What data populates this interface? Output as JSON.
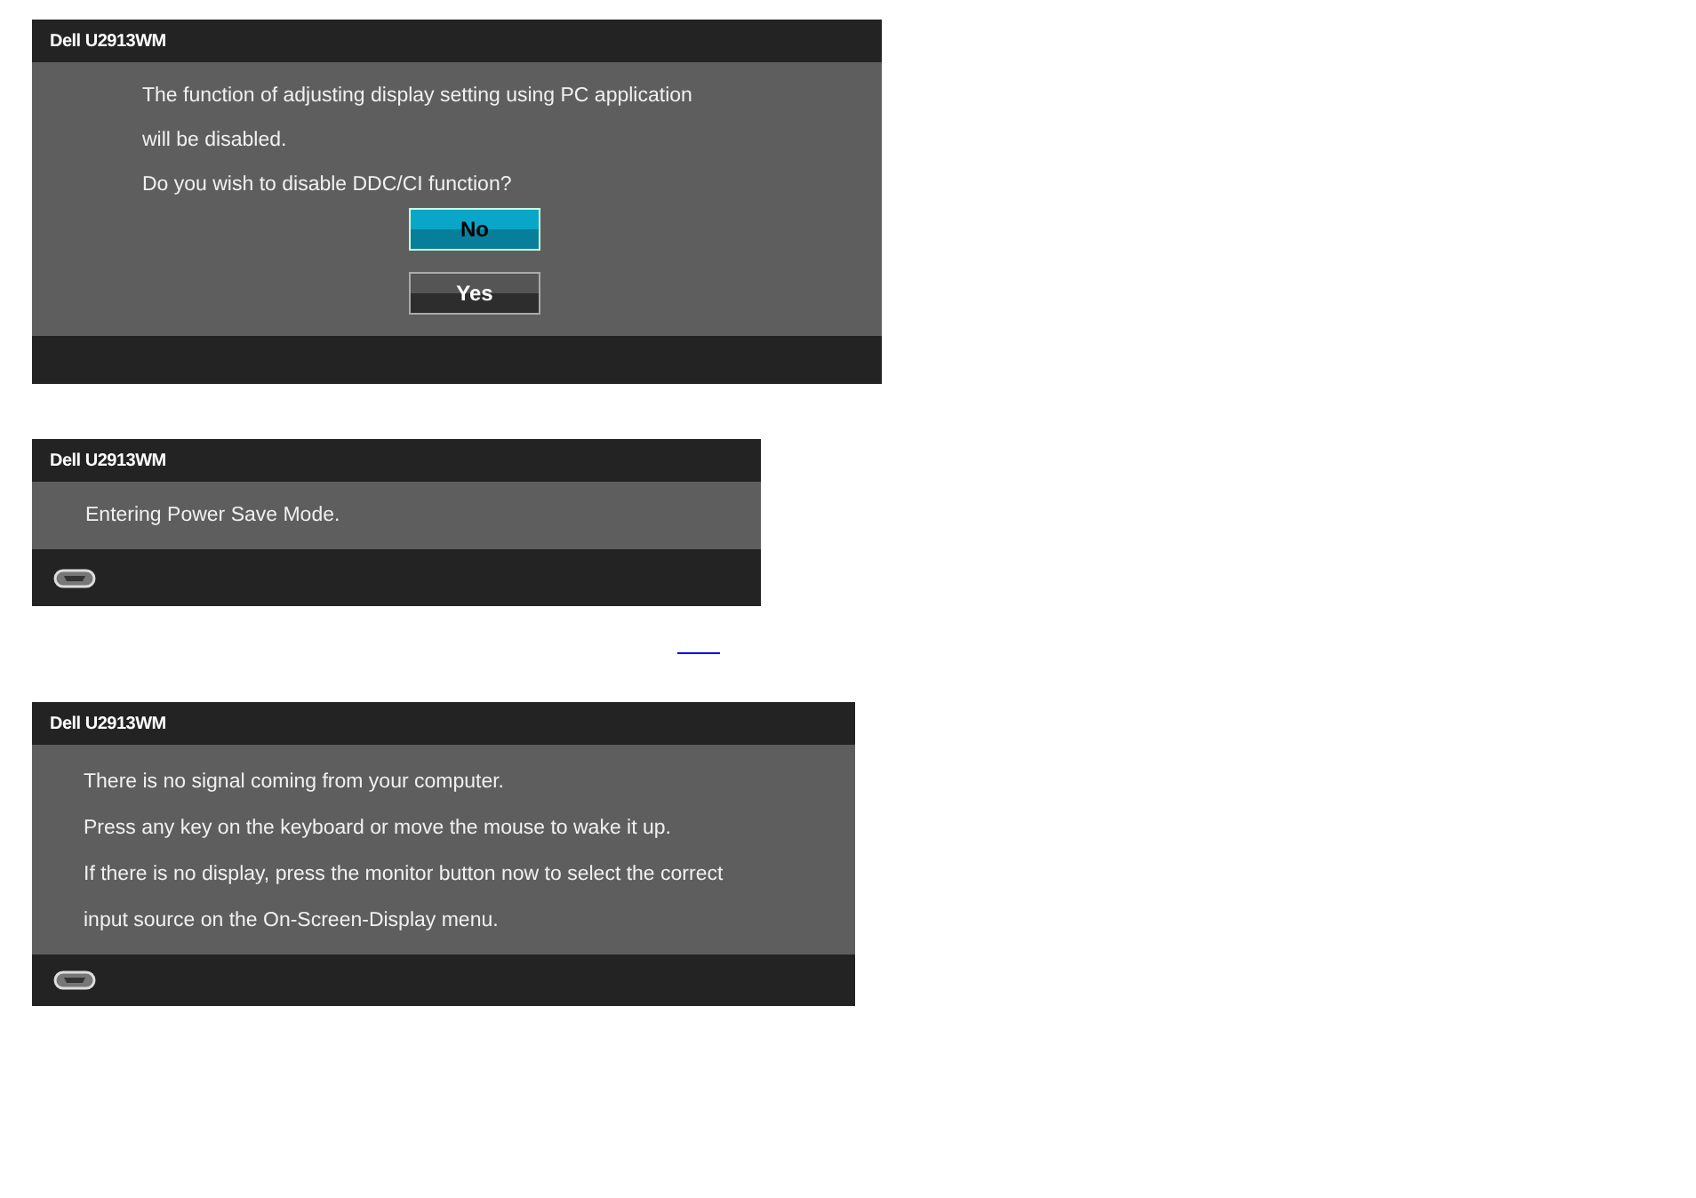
{
  "dialogs": [
    {
      "title": "Dell U2913WM",
      "kind": "confirm",
      "lines": [
        "The function of adjusting display setting using PC application",
        "will be disabled.",
        "Do you wish to disable DDC/CI function?"
      ],
      "buttons": [
        {
          "label": "No",
          "selected": true
        },
        {
          "label": "Yes",
          "selected": false
        }
      ],
      "footer_icon": false
    },
    {
      "title": "Dell U2913WM",
      "kind": "message",
      "lines": [
        "Entering Power Save Mode."
      ],
      "footer_icon": true
    },
    {
      "title": "Dell U2913WM",
      "kind": "message",
      "lines": [
        "There is no signal coming from your computer.",
        "Press any key on the keyboard or move the mouse to wake it up.",
        "If there is no display, press the monitor button now to select the correct",
        "input source on the On-Screen-Display menu."
      ],
      "footer_icon": true
    }
  ]
}
